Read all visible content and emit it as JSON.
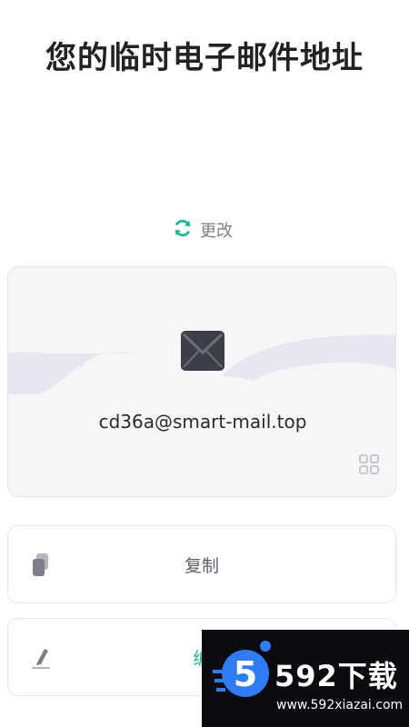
{
  "page": {
    "title": "您的临时电子邮件地址"
  },
  "refresh": {
    "label": "更改",
    "icon": "refresh-icon"
  },
  "email_card": {
    "address": "cd36a@smart-mail.top",
    "icon": "mail-icon",
    "qr_icon": "qr-code-icon"
  },
  "actions": [
    {
      "label": "复制",
      "icon": "copy-icon"
    },
    {
      "label": "编",
      "icon": "edit-icon"
    }
  ],
  "watermark": {
    "brand": "592下载",
    "url": "www.592xiazai.com"
  },
  "colors": {
    "accent": "#1fb58e",
    "card_bg": "#f6f6f9",
    "wave": "#e6e7ef"
  }
}
